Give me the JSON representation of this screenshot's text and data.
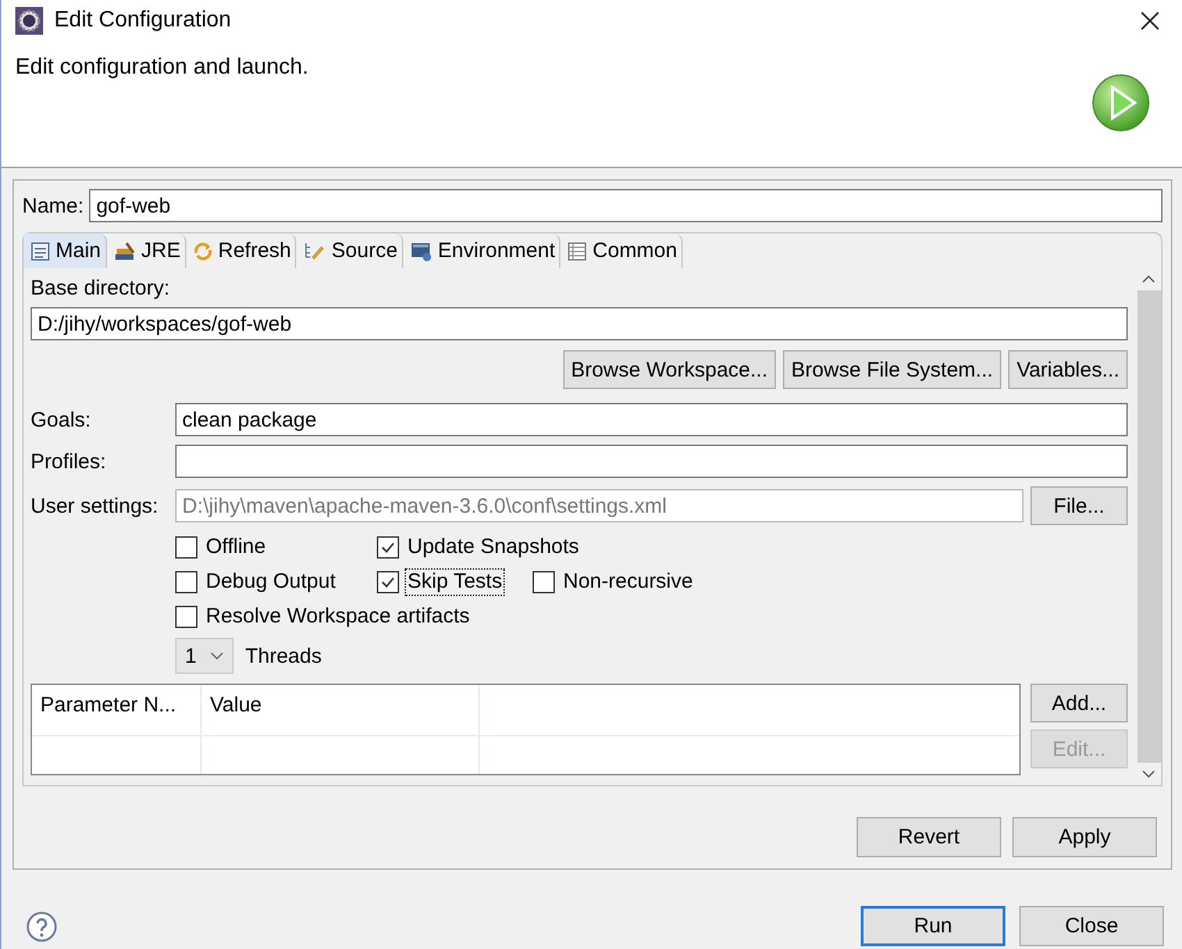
{
  "window": {
    "title": "Edit Configuration"
  },
  "header": {
    "description": "Edit configuration and launch."
  },
  "name_field": {
    "label": "Name:",
    "value": "gof-web"
  },
  "tabs": [
    {
      "label": "Main",
      "selected": true
    },
    {
      "label": "JRE",
      "selected": false
    },
    {
      "label": "Refresh",
      "selected": false
    },
    {
      "label": "Source",
      "selected": false
    },
    {
      "label": "Environment",
      "selected": false
    },
    {
      "label": "Common",
      "selected": false
    }
  ],
  "base_directory": {
    "label": "Base directory:",
    "value": "D:/jihy/workspaces/gof-web",
    "buttons": [
      {
        "label": "Browse Workspace..."
      },
      {
        "label": "Browse File System..."
      },
      {
        "label": "Variables..."
      }
    ]
  },
  "fields": [
    {
      "label": "Goals:",
      "value": "clean package",
      "disabled": false
    },
    {
      "label": "Profiles:",
      "disabled": false
    },
    {
      "label": "User settings:",
      "value": "D:\\jihy\\maven\\apache-maven-3.6.0\\conf\\settings.xml",
      "disabled": true,
      "button": "File..."
    }
  ],
  "options": [
    [
      {
        "label": "Offline",
        "checked": false,
        "focused": false
      },
      {
        "label": "Update Snapshots",
        "checked": true,
        "focused": false
      }
    ],
    [
      {
        "label": "Debug Output",
        "checked": false,
        "focused": false
      },
      {
        "label": "Skip Tests",
        "checked": true,
        "focused": true
      },
      {
        "label": "Non-recursive",
        "checked": false,
        "focused": false
      }
    ],
    [
      {
        "label": "Resolve Workspace artifacts",
        "checked": false,
        "focused": false
      }
    ]
  ],
  "threads": {
    "value": "1",
    "label": "Threads"
  },
  "parameters_table": {
    "columns": [
      "Parameter N...",
      "Value"
    ]
  },
  "table_buttons": [
    {
      "label": "Add...",
      "disabled": false
    },
    {
      "label": "Edit...",
      "disabled": true
    }
  ],
  "form_buttons": [
    {
      "label": "Revert"
    },
    {
      "label": "Apply"
    }
  ],
  "dialog_buttons": [
    {
      "label": "Run",
      "default": true
    },
    {
      "label": "Close",
      "default": false
    }
  ]
}
